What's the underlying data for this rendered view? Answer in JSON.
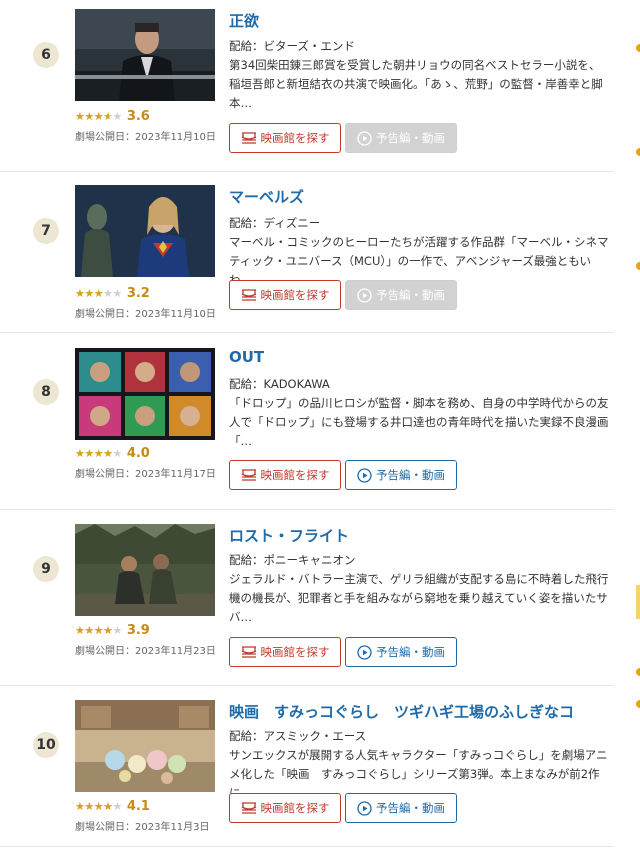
{
  "common": {
    "theater_label": "映画館を探す",
    "trailer_label": "予告編・動画"
  },
  "movies": [
    {
      "rank": "6",
      "title": "正欲",
      "distributor": "配給：ビターズ・エンド",
      "description": "第34回柴田錬三郎賞を受賞した朝井リョウの同名ベストセラー小説を、稲垣吾郎と新垣結衣の共演で映画化。「あゝ、荒野」の監督・岸善幸と脚本…",
      "rating": 3.6,
      "score": "3.6",
      "release": "劇場公開日：2023年11月10日",
      "trailer_available": false
    },
    {
      "rank": "7",
      "title": "マーベルズ",
      "distributor": "配給：ディズニー",
      "description": "マーベル・コミックのヒーローたちが活躍する作品群「マーベル・シネマティック・ユニバース（MCU）」の一作で、アベンジャーズ最強ともいわ…",
      "rating": 3.2,
      "score": "3.2",
      "release": "劇場公開日：2023年11月10日",
      "trailer_available": false
    },
    {
      "rank": "8",
      "title": "OUT",
      "distributor": "配給：KADOKAWA",
      "description": "「ドロップ」の品川ヒロシが監督・脚本を務め、自身の中学時代からの友人で「ドロップ」にも登場する井口達也の青年時代を描いた実録不良漫画「…",
      "rating": 4.0,
      "score": "4.0",
      "release": "劇場公開日：2023年11月17日",
      "trailer_available": true
    },
    {
      "rank": "9",
      "title": "ロスト・フライト",
      "distributor": "配給：ポニーキャニオン",
      "description": "ジェラルド・バトラー主演で、ゲリラ組織が支配する島に不時着した飛行機の機長が、犯罪者と手を組みながら窮地を乗り越えていく姿を描いたサバ…",
      "rating": 3.9,
      "score": "3.9",
      "release": "劇場公開日：2023年11月23日",
      "trailer_available": true
    },
    {
      "rank": "10",
      "title": "映画　すみっコぐらし　ツギハギ工場のふしぎなコ",
      "distributor": "配給：アスミック・エース",
      "description": "サンエックスが展開する人気キャラクター「すみっコぐらし」を劇場アニメ化した「映画　すみっコぐらし」シリーズ第3弾。本上まなみが前2作に…",
      "rating": 4.1,
      "score": "4.1",
      "release": "劇場公開日：2023年11月3日",
      "trailer_available": true
    }
  ]
}
